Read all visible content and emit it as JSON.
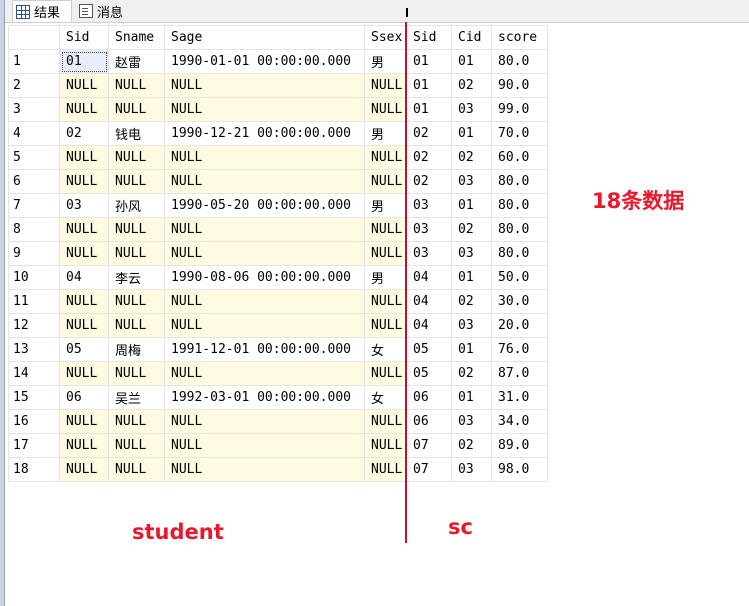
{
  "tabs": [
    {
      "label": "结果",
      "icon": "grid-icon"
    },
    {
      "label": "消息",
      "icon": "message-icon"
    }
  ],
  "grid": {
    "columns": [
      "",
      "Sid",
      "Sname",
      "Sage",
      "Ssex",
      "Sid",
      "Cid",
      "score"
    ],
    "rows": [
      [
        "1",
        "01",
        "赵雷",
        "1990-01-01 00:00:00.000",
        "男",
        "01",
        "01",
        "80.0"
      ],
      [
        "2",
        "NULL",
        "NULL",
        "NULL",
        "NULL",
        "01",
        "02",
        "90.0"
      ],
      [
        "3",
        "NULL",
        "NULL",
        "NULL",
        "NULL",
        "01",
        "03",
        "99.0"
      ],
      [
        "4",
        "02",
        "钱电",
        "1990-12-21 00:00:00.000",
        "男",
        "02",
        "01",
        "70.0"
      ],
      [
        "5",
        "NULL",
        "NULL",
        "NULL",
        "NULL",
        "02",
        "02",
        "60.0"
      ],
      [
        "6",
        "NULL",
        "NULL",
        "NULL",
        "NULL",
        "02",
        "03",
        "80.0"
      ],
      [
        "7",
        "03",
        "孙风",
        "1990-05-20 00:00:00.000",
        "男",
        "03",
        "01",
        "80.0"
      ],
      [
        "8",
        "NULL",
        "NULL",
        "NULL",
        "NULL",
        "03",
        "02",
        "80.0"
      ],
      [
        "9",
        "NULL",
        "NULL",
        "NULL",
        "NULL",
        "03",
        "03",
        "80.0"
      ],
      [
        "10",
        "04",
        "李云",
        "1990-08-06 00:00:00.000",
        "男",
        "04",
        "01",
        "50.0"
      ],
      [
        "11",
        "NULL",
        "NULL",
        "NULL",
        "NULL",
        "04",
        "02",
        "30.0"
      ],
      [
        "12",
        "NULL",
        "NULL",
        "NULL",
        "NULL",
        "04",
        "03",
        "20.0"
      ],
      [
        "13",
        "05",
        "周梅",
        "1991-12-01 00:00:00.000",
        "女",
        "05",
        "01",
        "76.0"
      ],
      [
        "14",
        "NULL",
        "NULL",
        "NULL",
        "NULL",
        "05",
        "02",
        "87.0"
      ],
      [
        "15",
        "06",
        "吴兰",
        "1992-03-01 00:00:00.000",
        "女",
        "06",
        "01",
        "31.0"
      ],
      [
        "16",
        "NULL",
        "NULL",
        "NULL",
        "NULL",
        "06",
        "03",
        "34.0"
      ],
      [
        "17",
        "NULL",
        "NULL",
        "NULL",
        "NULL",
        "07",
        "02",
        "89.0"
      ],
      [
        "18",
        "NULL",
        "NULL",
        "NULL",
        "NULL",
        "07",
        "03",
        "98.0"
      ]
    ]
  },
  "annotations": {
    "row_count": "18条数据",
    "left_table": "student",
    "right_table": "sc",
    "color": "#e8192c"
  },
  "colors": {
    "null_cell": "#fffbe0",
    "divider": "#c8102e"
  }
}
